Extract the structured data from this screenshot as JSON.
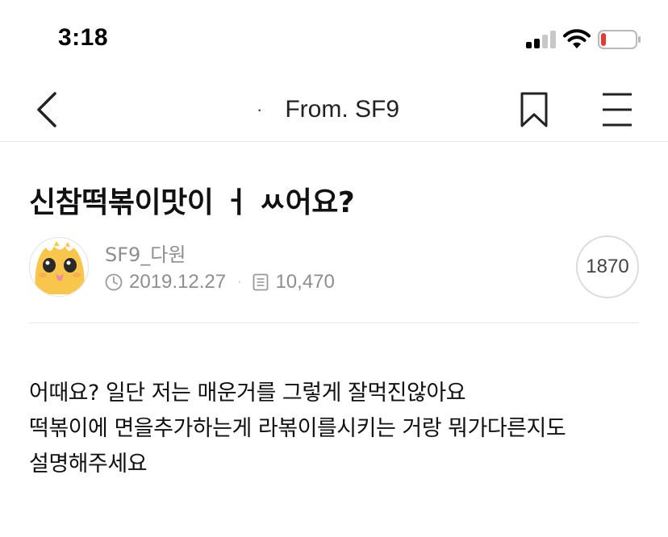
{
  "status_bar": {
    "time": "3:18",
    "battery_level": 0.15,
    "battery_color": "#e53935"
  },
  "nav": {
    "title": "From. SF9",
    "title_prefix": "·"
  },
  "post": {
    "title": "신참떡볶이맛이 ㅓ ㅆ어요?",
    "author": "SF9_다원",
    "date": "2019.12.27",
    "view_count": "10,470",
    "like_count": "1870",
    "body_lines": [
      "어때요? 일단 저는 매운거를 그렇게 잘먹진않아요",
      "떡볶이에 면을추가하는게 라볶이를시키는 거랑 뭐가다른지도",
      "설명해주세요"
    ]
  },
  "icons": {
    "back": "chevron-left-icon",
    "bookmark": "bookmark-icon",
    "menu": "hamburger-menu-icon",
    "clock": "clock-icon",
    "views": "document-icon",
    "signal": "cellular-signal-icon",
    "wifi": "wifi-icon",
    "battery": "battery-icon"
  }
}
